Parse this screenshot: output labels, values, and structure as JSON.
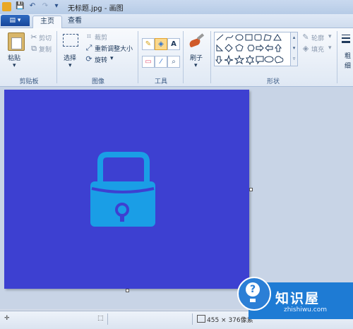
{
  "window": {
    "title": "无标题.jpg - 画图"
  },
  "quick_access": {
    "save_icon": "💾",
    "undo_icon": "↶",
    "redo_icon": "↷"
  },
  "tabs": {
    "file_label": "▤ ▾",
    "home": "主页",
    "view": "查看"
  },
  "clipboard": {
    "paste": "粘贴",
    "cut": "剪切",
    "copy": "复制",
    "label": "剪贴板"
  },
  "image": {
    "select": "选择",
    "crop": "裁剪",
    "resize": "重新调整大小",
    "rotate": "旋转",
    "label": "图像"
  },
  "tools": {
    "label": "工具"
  },
  "brushes": {
    "label": "刷子"
  },
  "shapes": {
    "outline": "轮廓",
    "fill": "填充",
    "label": "形状"
  },
  "colors": {
    "size_label_1": "粗",
    "size_label_2": "细"
  },
  "status": {
    "cursor_icon": "✛",
    "selection_icon": "⬚",
    "size": "455 × 376像素"
  },
  "canvas": {
    "background": "#3d40d1",
    "icon_color": "#1a9ee6",
    "icon_name": "lock-icon"
  },
  "watermark": {
    "title": "知识屋",
    "url": "zhishiwu.com",
    "icon_mark": "?"
  }
}
